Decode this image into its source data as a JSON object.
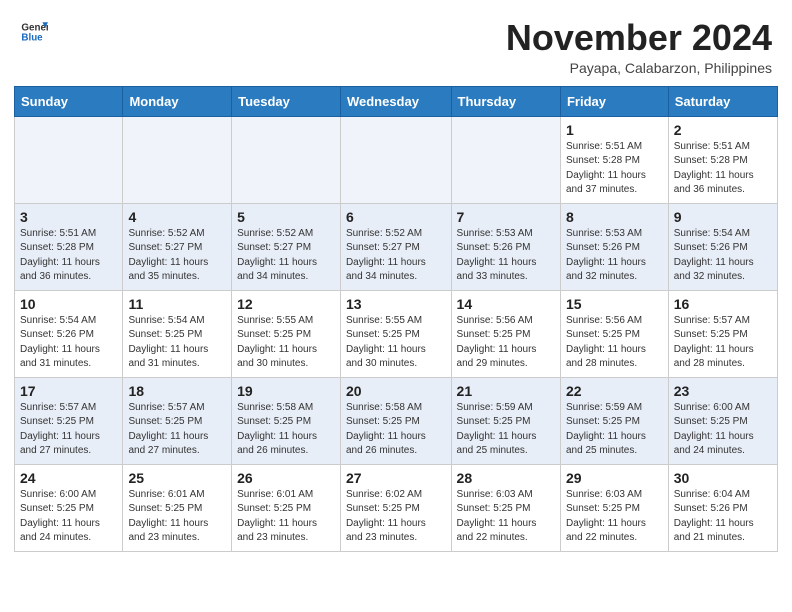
{
  "header": {
    "logo_general": "General",
    "logo_blue": "Blue",
    "month_title": "November 2024",
    "subtitle": "Payapa, Calabarzon, Philippines"
  },
  "days_of_week": [
    "Sunday",
    "Monday",
    "Tuesday",
    "Wednesday",
    "Thursday",
    "Friday",
    "Saturday"
  ],
  "weeks": [
    [
      {
        "day": "",
        "info": ""
      },
      {
        "day": "",
        "info": ""
      },
      {
        "day": "",
        "info": ""
      },
      {
        "day": "",
        "info": ""
      },
      {
        "day": "",
        "info": ""
      },
      {
        "day": "1",
        "info": "Sunrise: 5:51 AM\nSunset: 5:28 PM\nDaylight: 11 hours\nand 37 minutes."
      },
      {
        "day": "2",
        "info": "Sunrise: 5:51 AM\nSunset: 5:28 PM\nDaylight: 11 hours\nand 36 minutes."
      }
    ],
    [
      {
        "day": "3",
        "info": "Sunrise: 5:51 AM\nSunset: 5:28 PM\nDaylight: 11 hours\nand 36 minutes."
      },
      {
        "day": "4",
        "info": "Sunrise: 5:52 AM\nSunset: 5:27 PM\nDaylight: 11 hours\nand 35 minutes."
      },
      {
        "day": "5",
        "info": "Sunrise: 5:52 AM\nSunset: 5:27 PM\nDaylight: 11 hours\nand 34 minutes."
      },
      {
        "day": "6",
        "info": "Sunrise: 5:52 AM\nSunset: 5:27 PM\nDaylight: 11 hours\nand 34 minutes."
      },
      {
        "day": "7",
        "info": "Sunrise: 5:53 AM\nSunset: 5:26 PM\nDaylight: 11 hours\nand 33 minutes."
      },
      {
        "day": "8",
        "info": "Sunrise: 5:53 AM\nSunset: 5:26 PM\nDaylight: 11 hours\nand 32 minutes."
      },
      {
        "day": "9",
        "info": "Sunrise: 5:54 AM\nSunset: 5:26 PM\nDaylight: 11 hours\nand 32 minutes."
      }
    ],
    [
      {
        "day": "10",
        "info": "Sunrise: 5:54 AM\nSunset: 5:26 PM\nDaylight: 11 hours\nand 31 minutes."
      },
      {
        "day": "11",
        "info": "Sunrise: 5:54 AM\nSunset: 5:25 PM\nDaylight: 11 hours\nand 31 minutes."
      },
      {
        "day": "12",
        "info": "Sunrise: 5:55 AM\nSunset: 5:25 PM\nDaylight: 11 hours\nand 30 minutes."
      },
      {
        "day": "13",
        "info": "Sunrise: 5:55 AM\nSunset: 5:25 PM\nDaylight: 11 hours\nand 30 minutes."
      },
      {
        "day": "14",
        "info": "Sunrise: 5:56 AM\nSunset: 5:25 PM\nDaylight: 11 hours\nand 29 minutes."
      },
      {
        "day": "15",
        "info": "Sunrise: 5:56 AM\nSunset: 5:25 PM\nDaylight: 11 hours\nand 28 minutes."
      },
      {
        "day": "16",
        "info": "Sunrise: 5:57 AM\nSunset: 5:25 PM\nDaylight: 11 hours\nand 28 minutes."
      }
    ],
    [
      {
        "day": "17",
        "info": "Sunrise: 5:57 AM\nSunset: 5:25 PM\nDaylight: 11 hours\nand 27 minutes."
      },
      {
        "day": "18",
        "info": "Sunrise: 5:57 AM\nSunset: 5:25 PM\nDaylight: 11 hours\nand 27 minutes."
      },
      {
        "day": "19",
        "info": "Sunrise: 5:58 AM\nSunset: 5:25 PM\nDaylight: 11 hours\nand 26 minutes."
      },
      {
        "day": "20",
        "info": "Sunrise: 5:58 AM\nSunset: 5:25 PM\nDaylight: 11 hours\nand 26 minutes."
      },
      {
        "day": "21",
        "info": "Sunrise: 5:59 AM\nSunset: 5:25 PM\nDaylight: 11 hours\nand 25 minutes."
      },
      {
        "day": "22",
        "info": "Sunrise: 5:59 AM\nSunset: 5:25 PM\nDaylight: 11 hours\nand 25 minutes."
      },
      {
        "day": "23",
        "info": "Sunrise: 6:00 AM\nSunset: 5:25 PM\nDaylight: 11 hours\nand 24 minutes."
      }
    ],
    [
      {
        "day": "24",
        "info": "Sunrise: 6:00 AM\nSunset: 5:25 PM\nDaylight: 11 hours\nand 24 minutes."
      },
      {
        "day": "25",
        "info": "Sunrise: 6:01 AM\nSunset: 5:25 PM\nDaylight: 11 hours\nand 23 minutes."
      },
      {
        "day": "26",
        "info": "Sunrise: 6:01 AM\nSunset: 5:25 PM\nDaylight: 11 hours\nand 23 minutes."
      },
      {
        "day": "27",
        "info": "Sunrise: 6:02 AM\nSunset: 5:25 PM\nDaylight: 11 hours\nand 23 minutes."
      },
      {
        "day": "28",
        "info": "Sunrise: 6:03 AM\nSunset: 5:25 PM\nDaylight: 11 hours\nand 22 minutes."
      },
      {
        "day": "29",
        "info": "Sunrise: 6:03 AM\nSunset: 5:25 PM\nDaylight: 11 hours\nand 22 minutes."
      },
      {
        "day": "30",
        "info": "Sunrise: 6:04 AM\nSunset: 5:26 PM\nDaylight: 11 hours\nand 21 minutes."
      }
    ]
  ]
}
